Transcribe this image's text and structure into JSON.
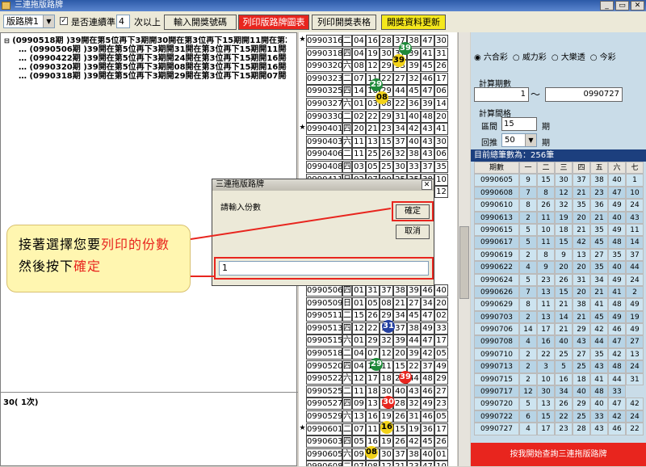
{
  "window": {
    "title": "三連拖版路牌",
    "btn_min": "_",
    "btn_restore": "▭",
    "btn_close": "✕"
  },
  "toolbar": {
    "layout_select": "版路牌1",
    "continuous_check_label": "是否連續準",
    "count_value": "4",
    "count_suffix": "次以上",
    "buttons": [
      "輸入開獎號碼",
      "列印版路牌圖表",
      "列印開獎表格",
      "開獎資料更新"
    ]
  },
  "tree": [
    "(0990518期 )39開在第5位再下3期開30開在第3位再下15期開11開在第2位",
    "(0990506期 )39開在第5位再下3期開31開在第3位再下15期開11開在第2",
    "(0990422期 )39開在第5位再下3期開24開在第3位再下15期開16開在第2",
    "(0990320期 )39開在第5位再下3期開08開在第3位再下15期開16開在第2",
    "(0990318期 )39開在第5位再下3期開29開在第3位再下15期開07開在第2"
  ],
  "log_text": "30(  1次)",
  "grid": {
    "rows_top": [
      {
        "star": "★",
        "p": "0990316",
        "d": "二",
        "n": [
          "04",
          "16",
          "28",
          "37",
          "38",
          "47",
          "30"
        ]
      },
      {
        "star": "",
        "p": "0990318",
        "d": "四",
        "n": [
          "04",
          "19",
          "30",
          "37",
          "39",
          "41",
          "31"
        ]
      },
      {
        "star": "",
        "p": "0990320",
        "d": "六",
        "n": [
          "08",
          "12",
          "29",
          "33",
          "39",
          "45",
          "26"
        ]
      },
      {
        "star": "",
        "p": "0990323",
        "d": "二",
        "n": [
          "07",
          "11",
          "22",
          "27",
          "32",
          "46",
          "17"
        ]
      },
      {
        "star": "",
        "p": "0990325",
        "d": "四",
        "n": [
          "14",
          "16",
          "29",
          "44",
          "45",
          "47",
          "06"
        ]
      },
      {
        "star": "",
        "p": "0990327",
        "d": "六",
        "n": [
          "01",
          "03",
          "08",
          "22",
          "36",
          "39",
          "14"
        ]
      },
      {
        "star": "",
        "p": "0990330",
        "d": "二",
        "n": [
          "02",
          "22",
          "29",
          "31",
          "40",
          "48",
          "20"
        ]
      },
      {
        "star": "★",
        "p": "0990401",
        "d": "四",
        "n": [
          "20",
          "21",
          "23",
          "34",
          "42",
          "43",
          "41"
        ]
      },
      {
        "star": "",
        "p": "0990403",
        "d": "六",
        "n": [
          "11",
          "13",
          "15",
          "37",
          "40",
          "43",
          "30"
        ]
      },
      {
        "star": "",
        "p": "0990406",
        "d": "二",
        "n": [
          "11",
          "25",
          "26",
          "32",
          "38",
          "43",
          "06"
        ]
      },
      {
        "star": "",
        "p": "0990408",
        "d": "四",
        "n": [
          "03",
          "05",
          "25",
          "30",
          "33",
          "37",
          "35"
        ]
      },
      {
        "star": "",
        "p": "0990411",
        "d": "日",
        "n": [
          "02",
          "07",
          "09",
          "25",
          "35",
          "38",
          "10"
        ]
      },
      {
        "star": "",
        "p": "0990413",
        "d": "二",
        "n": [
          "13",
          "32",
          "33",
          "37",
          "38",
          "46",
          "12"
        ]
      }
    ],
    "rows_bottom": [
      {
        "star": "",
        "p": "0990506",
        "d": "四",
        "n": [
          "01",
          "31",
          "37",
          "38",
          "39",
          "46",
          "40"
        ]
      },
      {
        "star": "",
        "p": "0990509",
        "d": "日",
        "n": [
          "01",
          "05",
          "08",
          "21",
          "27",
          "34",
          "20"
        ]
      },
      {
        "star": "",
        "p": "0990511",
        "d": "二",
        "n": [
          "15",
          "26",
          "29",
          "34",
          "45",
          "47",
          "02"
        ]
      },
      {
        "star": "",
        "p": "0990513",
        "d": "四",
        "n": [
          "12",
          "22",
          "31",
          "37",
          "38",
          "49",
          "33"
        ]
      },
      {
        "star": "",
        "p": "0990515",
        "d": "六",
        "n": [
          "01",
          "29",
          "32",
          "39",
          "44",
          "47",
          "17"
        ]
      },
      {
        "star": "",
        "p": "0990518",
        "d": "二",
        "n": [
          "04",
          "07",
          "12",
          "20",
          "39",
          "42",
          "05"
        ]
      },
      {
        "star": "",
        "p": "0990520",
        "d": "四",
        "n": [
          "04",
          "10",
          "11",
          "15",
          "22",
          "37",
          "49"
        ]
      },
      {
        "star": "",
        "p": "0990522",
        "d": "六",
        "n": [
          "12",
          "17",
          "18",
          "23",
          "44",
          "48",
          "29"
        ]
      },
      {
        "star": "",
        "p": "0990525",
        "d": "二",
        "n": [
          "11",
          "18",
          "30",
          "40",
          "43",
          "46",
          "27"
        ]
      },
      {
        "star": "",
        "p": "0990527",
        "d": "四",
        "n": [
          "09",
          "13",
          "22",
          "28",
          "32",
          "49",
          "23"
        ]
      },
      {
        "star": "",
        "p": "0990529",
        "d": "六",
        "n": [
          "13",
          "16",
          "19",
          "26",
          "31",
          "46",
          "05"
        ]
      },
      {
        "star": "★",
        "p": "0990601",
        "d": "二",
        "n": [
          "07",
          "11",
          "13",
          "15",
          "19",
          "36",
          "17"
        ]
      },
      {
        "star": "",
        "p": "0990603",
        "d": "四",
        "n": [
          "05",
          "16",
          "19",
          "26",
          "42",
          "45",
          "26"
        ]
      },
      {
        "star": "",
        "p": "0990605",
        "d": "六",
        "n": [
          "09",
          "15",
          "30",
          "37",
          "38",
          "40",
          "01"
        ]
      },
      {
        "star": "",
        "p": "0990608",
        "d": "二",
        "n": [
          "07",
          "08",
          "12",
          "21",
          "23",
          "47",
          "10"
        ]
      },
      {
        "star": "",
        "p": "0990610",
        "d": "四",
        "n": [
          "08",
          "26",
          "32",
          "35",
          "36",
          "49",
          "24"
        ]
      }
    ]
  },
  "dialog": {
    "title": "三連拖版路牌",
    "prompt": "請輸入份數",
    "ok": "確定",
    "cancel": "取消",
    "input_value": "1",
    "close": "✕"
  },
  "callout": {
    "line1a": "接著選擇您要",
    "line1b": "列印的份數",
    "line2a": "然後按下",
    "line2b": "確定"
  },
  "right": {
    "radios": [
      "六合彩",
      "威力彩",
      "大樂透",
      "今彩"
    ],
    "period_label": "計算期數",
    "period_from": "1",
    "tilde": "〜",
    "period_to": "0990727",
    "interval_label": "計算間格",
    "gap_label": "區間",
    "gap_value": "15",
    "gap_unit": "期",
    "back_label": "回推",
    "back_value": "50",
    "back_unit": "期",
    "total_label": "目前總筆數為：256筆",
    "headers": [
      "期數",
      "一",
      "二",
      "三",
      "四",
      "五",
      "六",
      "七"
    ],
    "rows": [
      [
        "0990605",
        "9",
        "15",
        "30",
        "37",
        "38",
        "40",
        "1"
      ],
      [
        "0990608",
        "7",
        "8",
        "12",
        "21",
        "23",
        "47",
        "10"
      ],
      [
        "0990610",
        "8",
        "26",
        "32",
        "35",
        "36",
        "49",
        "24"
      ],
      [
        "0990613",
        "2",
        "11",
        "19",
        "20",
        "21",
        "40",
        "43"
      ],
      [
        "0990615",
        "5",
        "10",
        "18",
        "21",
        "35",
        "49",
        "11"
      ],
      [
        "0990617",
        "5",
        "11",
        "15",
        "42",
        "45",
        "48",
        "14"
      ],
      [
        "0990619",
        "2",
        "8",
        "9",
        "13",
        "27",
        "35",
        "37"
      ],
      [
        "0990622",
        "4",
        "9",
        "20",
        "20",
        "35",
        "40",
        "44"
      ],
      [
        "0990624",
        "5",
        "23",
        "26",
        "31",
        "34",
        "49",
        "24"
      ],
      [
        "0990626",
        "7",
        "13",
        "15",
        "20",
        "21",
        "41",
        "2"
      ],
      [
        "0990629",
        "8",
        "11",
        "21",
        "38",
        "41",
        "48",
        "49"
      ],
      [
        "0990703",
        "2",
        "13",
        "14",
        "21",
        "45",
        "49",
        "19"
      ],
      [
        "0990706",
        "14",
        "17",
        "21",
        "29",
        "42",
        "46",
        "49"
      ],
      [
        "0990708",
        "4",
        "16",
        "40",
        "43",
        "44",
        "47",
        "27"
      ],
      [
        "0990710",
        "2",
        "22",
        "25",
        "27",
        "35",
        "42",
        "13"
      ],
      [
        "0990713",
        "2",
        "3",
        "5",
        "25",
        "43",
        "48",
        "24"
      ],
      [
        "0990715",
        "2",
        "10",
        "16",
        "18",
        "41",
        "44",
        "31"
      ],
      [
        "0990717",
        "12",
        "30",
        "34",
        "40",
        "48",
        "33"
      ],
      [
        "0990720",
        "5",
        "13",
        "26",
        "29",
        "40",
        "47",
        "42"
      ],
      [
        "0990722",
        "6",
        "15",
        "22",
        "25",
        "33",
        "42",
        "24"
      ],
      [
        "0990727",
        "4",
        "17",
        "23",
        "28",
        "43",
        "46",
        "22"
      ]
    ],
    "query_button": "按我開始查詢三連拖版路牌"
  },
  "colors": {
    "accent_red": "#e8251e",
    "yellow_btn": "#f5e81c",
    "ball_green": "#1f8a3a",
    "ball_yellow": "#f2d218",
    "ball_blue": "#2440a0"
  }
}
